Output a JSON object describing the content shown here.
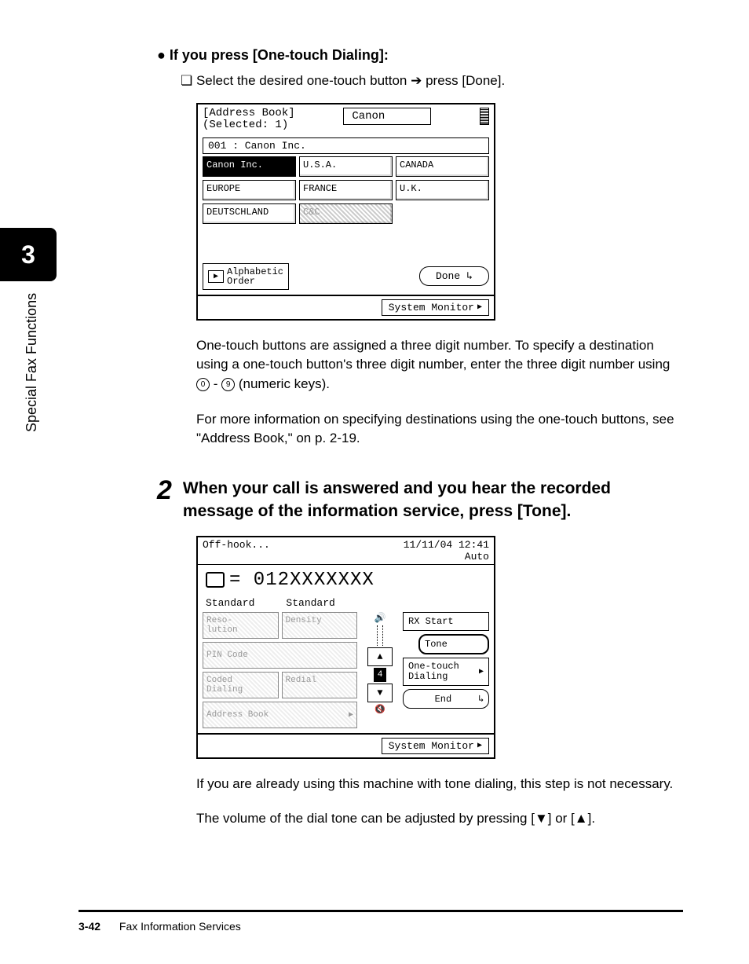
{
  "sideTab": {
    "chapter": "3",
    "label": "Special Fax Functions"
  },
  "section1": {
    "heading": "If you press [One-touch Dialing]:",
    "instruction_pre": "Select the desired one-touch button ",
    "instruction_post": " press [Done]."
  },
  "screenshot1": {
    "title_l1": "[Address Book]",
    "title_l2": "(Selected: 1)",
    "search": "Canon",
    "selected_row": "001 : Canon Inc.",
    "buttons": [
      "Canon Inc.",
      "U.S.A.",
      "CANADA",
      "EUROPE",
      "FRANCE",
      "U.K.",
      "DEUTSCHLAND",
      "C&C"
    ],
    "alpha": "Alphabetic\nOrder",
    "done": "Done",
    "sysmon": "System Monitor"
  },
  "para1": "One-touch buttons are assigned a three digit number. To specify a destination using a one-touch button's three digit number, enter the three digit number using ",
  "para1_mid": " - ",
  "para1_end": " (numeric keys).",
  "para2": "For more information on specifying destinations using the one-touch buttons, see \"Address Book,\" on p. 2-19.",
  "step2": {
    "num": "2",
    "heading": "When your call is answered and you hear the recorded message of the information service, press [Tone]."
  },
  "screenshot2": {
    "offhook": "Off-hook...",
    "date": "11/11/04 12:41",
    "auto": "Auto",
    "dial": "= 012XXXXXXX",
    "std1": "Standard",
    "std2": "Standard",
    "left_buttons": [
      "Reso-\nlution",
      "Density",
      "PIN Code",
      "",
      "Coded\nDialing",
      "Redial"
    ],
    "addrbook": "Address Book",
    "vol_num": "4",
    "rx": "RX Start",
    "tone": "Tone",
    "onetouch": "One-touch\nDialing",
    "end": "End",
    "sysmon": "System Monitor"
  },
  "para3": "If you are already using this machine with tone dialing, this step is not necessary.",
  "para4_pre": "The volume of the dial tone can be adjusted by pressing [",
  "para4_mid": "] or [",
  "para4_post": "].",
  "footer": {
    "page": "3-42",
    "title": "Fax Information Services"
  }
}
